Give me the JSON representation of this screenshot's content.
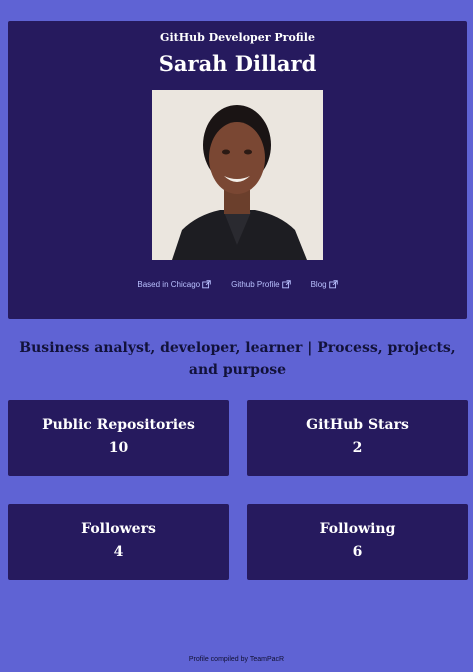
{
  "profile": {
    "subtitle": "GitHub Developer Profile",
    "name": "Sarah Dillard",
    "photo_alt": "Profile photo of Sarah Dillard"
  },
  "links": [
    {
      "label": "Based in Chicago",
      "icon": "external-link-icon"
    },
    {
      "label": "Github Profile",
      "icon": "external-link-icon"
    },
    {
      "label": "Blog",
      "icon": "external-link-icon"
    }
  ],
  "bio": "Business analyst, developer, learner | Process, projects, and purpose",
  "stats": [
    {
      "label": "Public Repositories",
      "value": "10"
    },
    {
      "label": "GitHub Stars",
      "value": "2"
    },
    {
      "label": "Followers",
      "value": "4"
    },
    {
      "label": "Following",
      "value": "6"
    }
  ],
  "footer": "Profile compiled by TeamPacR",
  "colors": {
    "page_background": "#5f63d4",
    "card_background": "#261a5e",
    "link": "#b9c1ff",
    "bio_text": "#12123a"
  }
}
